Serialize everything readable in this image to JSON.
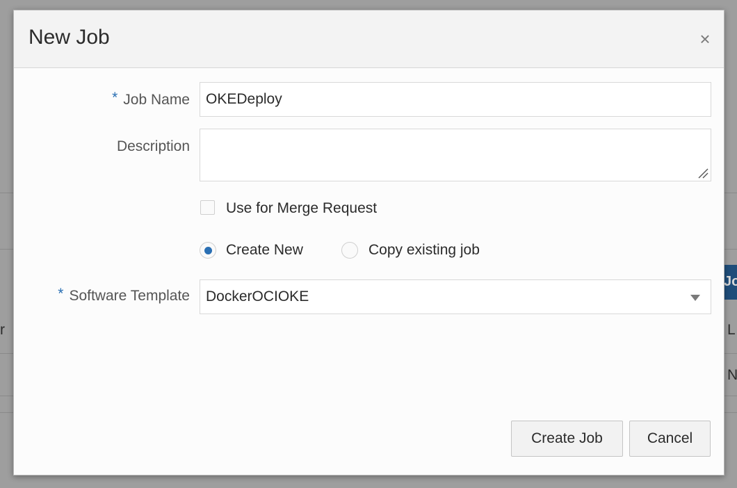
{
  "background": {
    "fragment_left": "r",
    "fragment_right_1": "L",
    "fragment_right_2": "N",
    "blue_button_text": "Jo"
  },
  "dialog": {
    "title": "New Job",
    "close_glyph": "×",
    "fields": {
      "job_name": {
        "label": "Job Name",
        "required_mark": "*",
        "value": "OKEDeploy"
      },
      "description": {
        "label": "Description",
        "value": ""
      },
      "merge_request": {
        "label": "Use for Merge Request",
        "checked": false
      },
      "mode": {
        "create_new": "Create New",
        "copy_existing": "Copy existing job",
        "selected": "create_new"
      },
      "software_template": {
        "label": "Software Template",
        "required_mark": "*",
        "value": "DockerOCIOKE"
      }
    },
    "buttons": {
      "create": "Create Job",
      "cancel": "Cancel"
    }
  },
  "colors": {
    "accent": "#2a6fb3",
    "text": "#2b2b2b",
    "label": "#555555"
  }
}
